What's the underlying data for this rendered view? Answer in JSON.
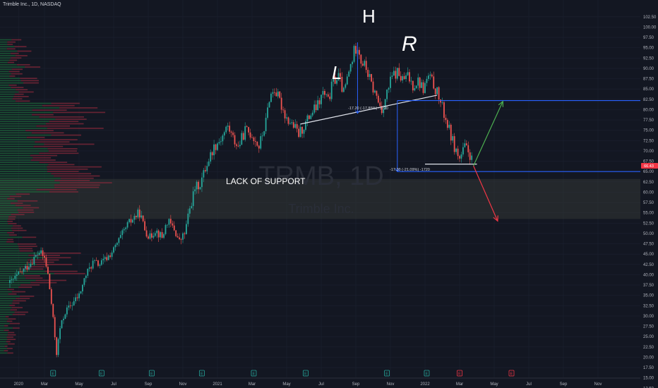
{
  "header": {
    "symbol_line": "Trimble Inc., 1D, NASDAQ"
  },
  "watermark": {
    "ticker": "TRMB, 1D",
    "company": "Trimble Inc."
  },
  "current_price_tag": "66.43",
  "annotations": {
    "support_zone": "LACK OF SUPPORT",
    "left_shoulder": "L",
    "head": "H",
    "right_shoulder": "R",
    "measure_top": "-17.20 (-17.85%) -1720",
    "measure_bottom": "-17.20 (-21.09%) -1720"
  },
  "colors": {
    "background": "#131722",
    "up": "#26a69a",
    "down": "#ef5350",
    "line_blue": "#2962ff",
    "arrow_green": "#4caf50",
    "arrow_red": "#f23645",
    "zone": "#3a3d3a",
    "vp_up": "#1e6b3a",
    "vp_down": "#8a2a3a"
  },
  "chart_data": {
    "type": "candlestick",
    "title": "Trimble Inc., 1D, NASDAQ",
    "xlabel": "",
    "ylabel": "",
    "ylim": [
      10,
      104
    ],
    "y_ticks": [
      "102.50",
      "100.00",
      "97.50",
      "95.00",
      "92.50",
      "90.00",
      "87.50",
      "85.00",
      "82.50",
      "80.00",
      "77.50",
      "75.00",
      "72.50",
      "70.00",
      "67.50",
      "65.00",
      "62.50",
      "60.00",
      "57.50",
      "55.00",
      "52.50",
      "50.00",
      "47.50",
      "45.00",
      "42.50",
      "40.00",
      "37.50",
      "35.00",
      "32.50",
      "30.00",
      "27.50",
      "25.00",
      "22.50",
      "20.00",
      "17.50",
      "15.00",
      "12.50"
    ],
    "x_ticks": [
      {
        "label": "2020",
        "t": 0.5
      },
      {
        "label": "Mar",
        "t": 2
      },
      {
        "label": "May",
        "t": 4
      },
      {
        "label": "Jul",
        "t": 6
      },
      {
        "label": "Sep",
        "t": 8
      },
      {
        "label": "Nov",
        "t": 10
      },
      {
        "label": "2021",
        "t": 12
      },
      {
        "label": "Mar",
        "t": 14
      },
      {
        "label": "May",
        "t": 16
      },
      {
        "label": "Jul",
        "t": 18
      },
      {
        "label": "Sep",
        "t": 20
      },
      {
        "label": "Nov",
        "t": 22
      },
      {
        "label": "2022",
        "t": 24
      },
      {
        "label": "Mar",
        "t": 26
      },
      {
        "label": "May",
        "t": 28
      },
      {
        "label": "Jul",
        "t": 30
      },
      {
        "label": "Sep",
        "t": 32
      },
      {
        "label": "Nov",
        "t": 34
      }
    ],
    "price_path": [
      [
        0,
        38
      ],
      [
        0.5,
        40
      ],
      [
        1,
        42
      ],
      [
        1.4,
        44
      ],
      [
        1.7,
        45.5
      ],
      [
        2.0,
        44
      ],
      [
        2.2,
        40
      ],
      [
        2.4,
        33
      ],
      [
        2.6,
        25
      ],
      [
        2.7,
        21
      ],
      [
        2.9,
        27
      ],
      [
        3.2,
        31
      ],
      [
        3.6,
        33
      ],
      [
        4.0,
        35
      ],
      [
        4.4,
        40
      ],
      [
        4.8,
        43
      ],
      [
        5.2,
        42.5
      ],
      [
        5.6,
        44
      ],
      [
        6.0,
        46
      ],
      [
        6.4,
        49
      ],
      [
        6.8,
        52
      ],
      [
        7.2,
        54
      ],
      [
        7.5,
        55
      ],
      [
        7.8,
        51
      ],
      [
        8.1,
        49
      ],
      [
        8.4,
        51
      ],
      [
        8.8,
        49
      ],
      [
        9.1,
        53
      ],
      [
        9.5,
        51
      ],
      [
        9.8,
        48
      ],
      [
        10.1,
        50
      ],
      [
        10.4,
        56
      ],
      [
        10.7,
        61
      ],
      [
        11.0,
        62
      ],
      [
        11.4,
        67
      ],
      [
        11.8,
        71
      ],
      [
        12.2,
        73
      ],
      [
        12.6,
        76
      ],
      [
        12.9,
        73
      ],
      [
        13.2,
        71
      ],
      [
        13.6,
        75
      ],
      [
        14.0,
        74
      ],
      [
        14.4,
        71
      ],
      [
        14.8,
        77
      ],
      [
        15.0,
        83
      ],
      [
        15.3,
        85
      ],
      [
        15.6,
        82
      ],
      [
        16.0,
        78
      ],
      [
        16.4,
        76
      ],
      [
        16.7,
        74
      ],
      [
        17.0,
        76
      ],
      [
        17.4,
        79
      ],
      [
        17.8,
        81
      ],
      [
        18.1,
        84
      ],
      [
        18.4,
        82
      ],
      [
        18.7,
        87
      ],
      [
        19.0,
        88
      ],
      [
        19.3,
        84
      ],
      [
        19.6,
        89
      ],
      [
        19.9,
        94
      ],
      [
        20.1,
        96
      ],
      [
        20.3,
        92
      ],
      [
        20.6,
        90
      ],
      [
        20.9,
        86
      ],
      [
        21.2,
        83
      ],
      [
        21.5,
        80
      ],
      [
        21.8,
        84
      ],
      [
        22.1,
        88
      ],
      [
        22.4,
        89
      ],
      [
        22.7,
        87
      ],
      [
        23.0,
        88
      ],
      [
        23.3,
        86
      ],
      [
        23.6,
        87
      ],
      [
        23.9,
        85
      ],
      [
        24.2,
        88
      ],
      [
        24.5,
        86
      ],
      [
        24.8,
        83
      ],
      [
        25.1,
        79
      ],
      [
        25.4,
        75
      ],
      [
        25.7,
        71
      ],
      [
        26.0,
        68
      ],
      [
        26.3,
        71
      ],
      [
        26.6,
        69
      ],
      [
        26.8,
        66.4
      ]
    ],
    "series": [
      {
        "name": "Head & Shoulders neckline",
        "type": "trendline",
        "points": [
          [
            16.8,
            76.5
          ],
          [
            24.7,
            83.5
          ]
        ]
      },
      {
        "name": "Upper level",
        "type": "hline",
        "y": 82.2,
        "from": 22.4
      },
      {
        "name": "Lower level",
        "type": "hline",
        "y": 65.0,
        "from": 22.4
      },
      {
        "name": "Local bottom",
        "type": "hline",
        "y": 66.8,
        "from": 24.0,
        "to": 27.0
      }
    ],
    "zone": {
      "label": "LACK OF SUPPORT",
      "y_top": 63.2,
      "y_bottom": 53.5
    },
    "measures": [
      {
        "label": "-17.20 (-17.85%) -1720",
        "x": 20.1,
        "y_from": 96.3,
        "y_to": 79.1
      },
      {
        "label": "-17.20 (-21.09%) -1720",
        "x": 22.4,
        "y_from": 82.2,
        "y_to": 65.0
      }
    ],
    "projections": [
      {
        "direction": "up",
        "from": [
          26.8,
          66.4
        ],
        "to": [
          28.5,
          82.0
        ]
      },
      {
        "direction": "down",
        "from": [
          26.8,
          66.4
        ],
        "to": [
          28.2,
          53.0
        ]
      }
    ],
    "event_markers": [
      {
        "t": 2.5,
        "kind": "E"
      },
      {
        "t": 5.3,
        "kind": "E"
      },
      {
        "t": 8.2,
        "kind": "E"
      },
      {
        "t": 11.1,
        "kind": "E"
      },
      {
        "t": 14.1,
        "kind": "E"
      },
      {
        "t": 17.1,
        "kind": "E"
      },
      {
        "t": 21.8,
        "kind": "E"
      },
      {
        "t": 24.1,
        "kind": "E"
      },
      {
        "t": 26.0,
        "kind": "E-red"
      },
      {
        "t": 29.0,
        "kind": "E-red"
      }
    ],
    "grid": true,
    "legend": "none"
  }
}
